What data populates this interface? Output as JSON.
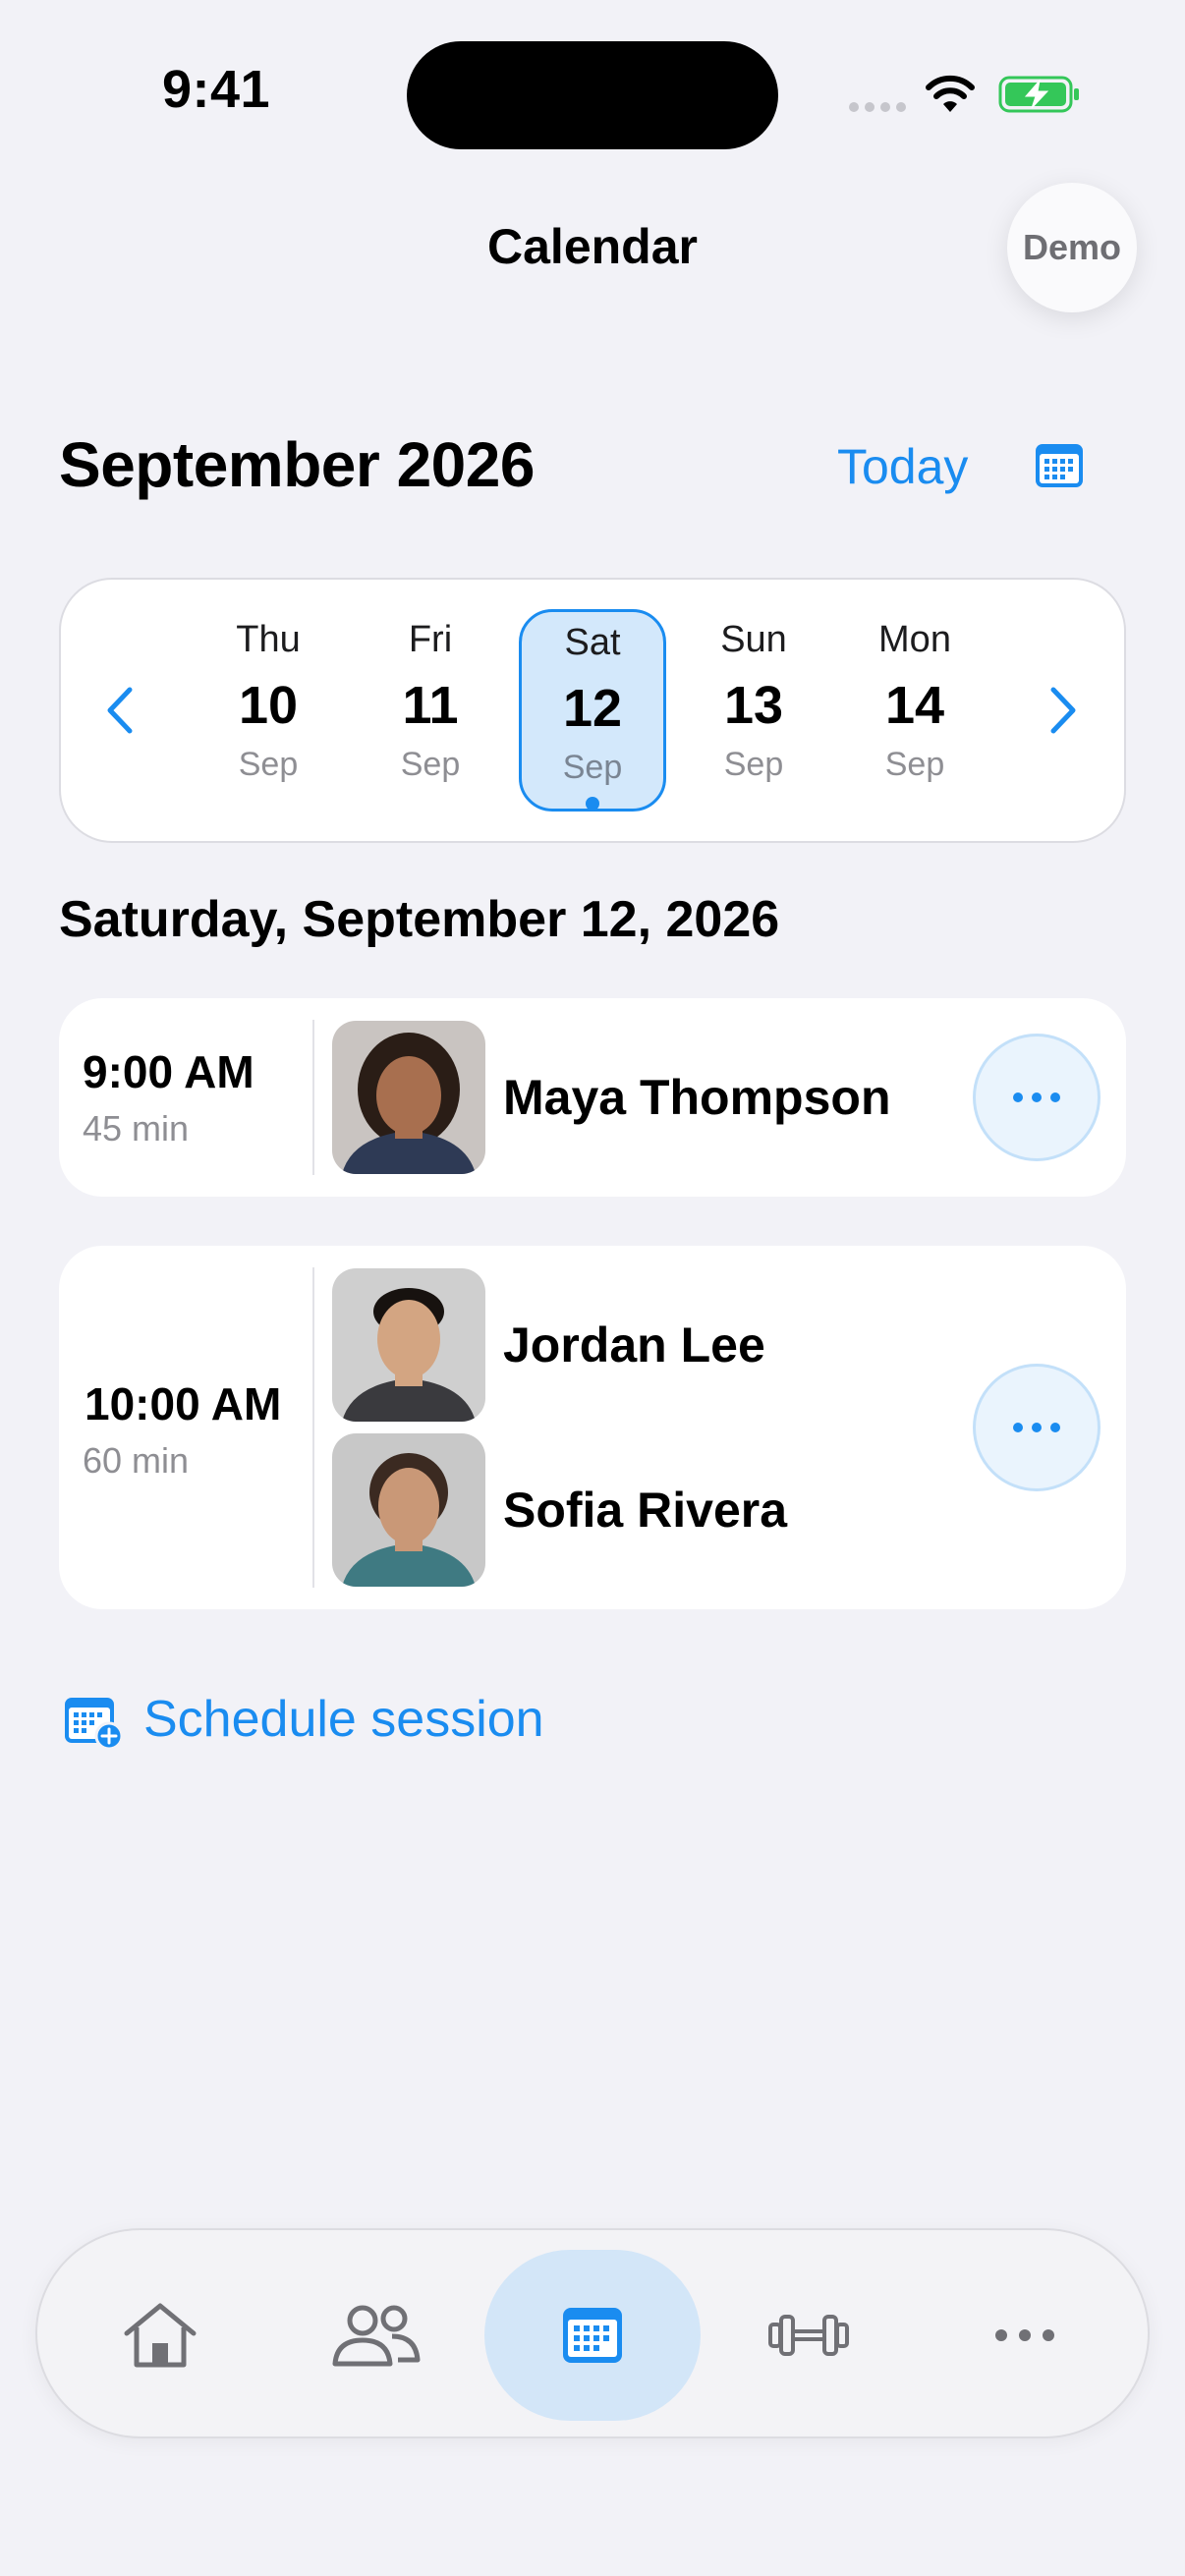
{
  "status_bar": {
    "time": "9:41"
  },
  "nav": {
    "title": "Calendar",
    "demo_label": "Demo"
  },
  "header": {
    "month_title": "September 2026",
    "today_label": "Today"
  },
  "week": {
    "days": [
      {
        "dow": "Thu",
        "num": "10",
        "mon": "Sep",
        "selected": false
      },
      {
        "dow": "Fri",
        "num": "11",
        "mon": "Sep",
        "selected": false
      },
      {
        "dow": "Sat",
        "num": "12",
        "mon": "Sep",
        "selected": true
      },
      {
        "dow": "Sun",
        "num": "13",
        "mon": "Sep",
        "selected": false
      },
      {
        "dow": "Mon",
        "num": "14",
        "mon": "Sep",
        "selected": false
      }
    ]
  },
  "date_heading": "Saturday, September 12, 2026",
  "sessions": [
    {
      "time": "9:00 AM",
      "duration": "45 min",
      "clients": [
        {
          "name": "Maya Thompson"
        }
      ]
    },
    {
      "time": "10:00 AM",
      "duration": "60 min",
      "clients": [
        {
          "name": "Jordan Lee"
        },
        {
          "name": "Sofia Rivera"
        }
      ]
    }
  ],
  "schedule_label": "Schedule session",
  "tabs": [
    {
      "icon": "home-icon",
      "active": false
    },
    {
      "icon": "people-icon",
      "active": false
    },
    {
      "icon": "calendar-icon",
      "active": true
    },
    {
      "icon": "dumbbell-icon",
      "active": false
    },
    {
      "icon": "more-icon",
      "active": false
    }
  ],
  "colors": {
    "accent": "#1a8cf0",
    "background": "#f2f2f7",
    "battery": "#34c759"
  }
}
